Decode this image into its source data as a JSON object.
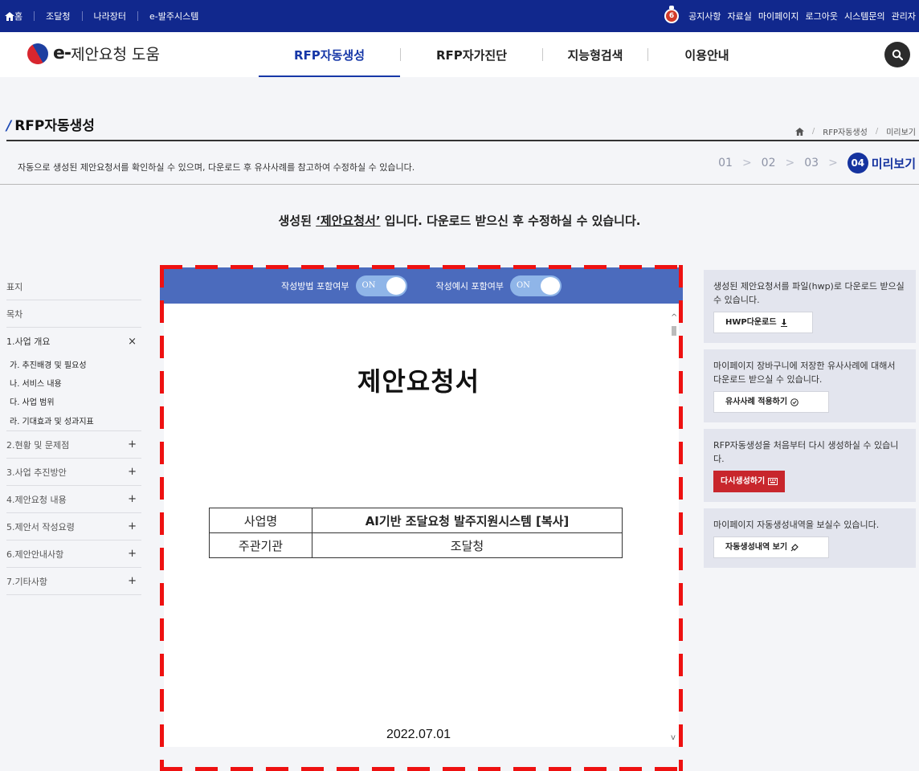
{
  "topbar": {
    "home": "홈",
    "links": [
      "조달청",
      "나라장터",
      "e-발주시스템"
    ],
    "notice_count": "6",
    "right_links": [
      "공지사항",
      "자료실",
      "마이페이지",
      "로그아웃",
      "시스템문의",
      "관리자"
    ]
  },
  "header": {
    "logo_prefix": "e-",
    "logo_text": "제안요청 도움",
    "nav": [
      "RFP자동생성",
      "RFP자가진단",
      "지능형검색",
      "이용안내"
    ],
    "active_nav": "RFP자동생성"
  },
  "page": {
    "title": "RFP자동생성",
    "breadcrumb": [
      "RFP자동생성",
      "미리보기"
    ],
    "description": "자동으로 생성된 제안요청서를 확인하실 수 있으며, 다운로드 후 유사사례를 참고하여 수정하실 수 있습니다.",
    "steps": [
      "01",
      "02",
      "03"
    ],
    "current_step_num": "04",
    "current_step_label": "미리보기",
    "headline_before": "생성된 ",
    "headline_doc": "‘제안요청서’",
    "headline_after": " 입니다. 다운로드 받으신 후 수정하실 수 있습니다."
  },
  "toc": {
    "cover": "표지",
    "contents": "목차",
    "section1": "1.사업 개요",
    "section1_sign": "×",
    "section1_items": [
      "가. 추진배경 및 필요성",
      "나. 서비스 내용",
      "다. 사업 범위",
      "라. 기대효과 및 성과지표"
    ],
    "sections": [
      {
        "label": "2.현황 및 문제점",
        "sign": "+"
      },
      {
        "label": "3.사업 추진방안",
        "sign": "+"
      },
      {
        "label": "4.제안요청 내용",
        "sign": "+"
      },
      {
        "label": "5.제안서 작성요령",
        "sign": "+"
      },
      {
        "label": "6.제안안내사항",
        "sign": "+"
      },
      {
        "label": "7.기타사항",
        "sign": "+"
      }
    ]
  },
  "viewer": {
    "toggle1_label": "작성방법 포함여부",
    "toggle1_state": "ON",
    "toggle2_label": "작성예시 포함여부",
    "toggle2_state": "ON",
    "doc_title": "제안요청서",
    "table": [
      {
        "key": "사업명",
        "value": "AI기반 조달요청 발주지원시스템 [복사]"
      },
      {
        "key": "주관기관",
        "value": "조달청"
      }
    ],
    "date": "2022.07.01"
  },
  "side": {
    "card1_text": "생성된 제안요청서를 파일(hwp)로 다운로드 받으실 수 있습니다.",
    "card1_btn": "HWP다운로드",
    "card2_text": "마이페이지 장바구니에 저장한 유사사례에 대해서 다운로드 받으실 수 있습니다.",
    "card2_btn": "유사사례 적용하기",
    "card3_text": "RFP자동생성을 처음부터 다시 생성하실 수 있습니다.",
    "card3_btn": "다시생성하기",
    "card4_text": "마이페이지 자동생성내역을 보실수 있습니다.",
    "card4_btn": "자동생성내역 보기"
  },
  "colors": {
    "topbar": "#11288d",
    "accent": "#15339f",
    "viewer_bar": "#4b6bbd",
    "highlight_dash": "#ee1111",
    "regen_button": "#c8262c"
  }
}
